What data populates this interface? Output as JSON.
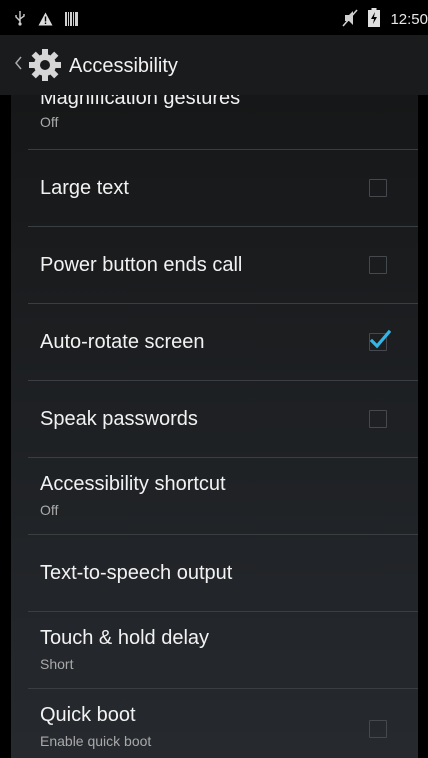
{
  "status_bar": {
    "icons": [
      "usb-icon",
      "warning-icon",
      "barcode-icon",
      "mute-icon",
      "battery-charging-icon"
    ],
    "time": "12:50"
  },
  "action_bar": {
    "title": "Accessibility",
    "icon": "settings-gear-icon"
  },
  "preferences": [
    {
      "title": "Magnification gestures",
      "summary": "Off",
      "has_checkbox": false
    },
    {
      "title": "Large text",
      "summary": "",
      "has_checkbox": true,
      "checked": false
    },
    {
      "title": "Power button ends call",
      "summary": "",
      "has_checkbox": true,
      "checked": false
    },
    {
      "title": "Auto-rotate screen",
      "summary": "",
      "has_checkbox": true,
      "checked": true
    },
    {
      "title": "Speak passwords",
      "summary": "",
      "has_checkbox": true,
      "checked": false
    },
    {
      "title": "Accessibility shortcut",
      "summary": "Off",
      "has_checkbox": false
    },
    {
      "title": "Text-to-speech output",
      "summary": "",
      "has_checkbox": false
    },
    {
      "title": "Touch & hold delay",
      "summary": "Short",
      "has_checkbox": false
    },
    {
      "title": "Quick boot",
      "summary": "Enable quick boot",
      "has_checkbox": true,
      "checked": false
    }
  ],
  "colors": {
    "accent": "#33b5e5",
    "background": "#1c1e21",
    "divider": "#3a3d42"
  }
}
